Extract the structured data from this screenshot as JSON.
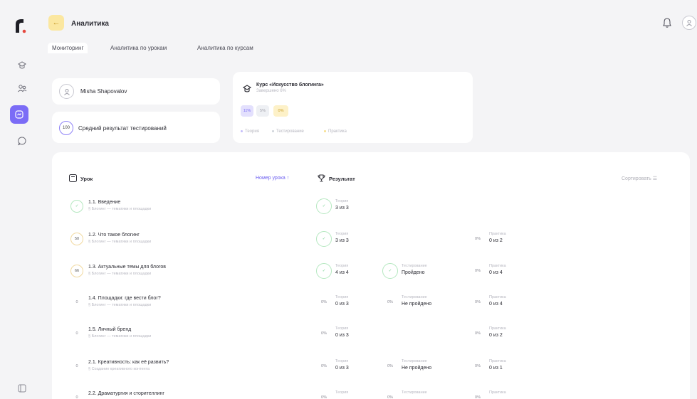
{
  "header": {
    "title": "Аналитика"
  },
  "tabs": [
    {
      "label": "Мониторинг",
      "active": true
    },
    {
      "label": "Аналитика по урокам",
      "active": false
    },
    {
      "label": "Аналитика по курсам",
      "active": false
    }
  ],
  "user": {
    "name": "Misha Shapovalov"
  },
  "score": {
    "badge": "100",
    "label": "Средний результат тестирований"
  },
  "course": {
    "title": "Курс «Искусство блогинга»",
    "subtitle": "Завершено 6%",
    "pills": [
      {
        "label": "11%",
        "color": "#e3e0fd",
        "text": "#7b6cf6"
      },
      {
        "label": "5%",
        "color": "#eef0f4",
        "text": "#a0a0aa"
      },
      {
        "label": "0%",
        "color": "#fdf1c8",
        "text": "#c9a02c"
      }
    ],
    "legend": [
      {
        "label": "Теория",
        "color": "#c4bdfb"
      },
      {
        "label": "Тестирование",
        "color": "#cfd3da"
      },
      {
        "label": "Практика",
        "color": "#f7df8d"
      }
    ]
  },
  "table": {
    "lesson_header": "Урок",
    "sort_lesson": "Номер урока",
    "result_header": "Результат",
    "sort_result": "Сортировать"
  },
  "lessons": [
    {
      "progress": "✓",
      "title": "1.1. Введение",
      "section": "§ Блогинг — тематики и площадки",
      "theory": {
        "cap": "Теория",
        "val": "3 из 3",
        "done": true
      }
    },
    {
      "progress": "50",
      "title": "1.2. Что такое блогинг",
      "section": "§ Блогинг — тематики и площадки",
      "theory": {
        "cap": "Теория",
        "val": "3 из 3",
        "done": true
      },
      "practice": {
        "cap": "Практика",
        "val": "0 из 2"
      }
    },
    {
      "progress": "66",
      "title": "1.3. Актуальные темы для блогов",
      "section": "§ Блогинг — тематики и площадки",
      "theory": {
        "cap": "Теория",
        "val": "4 из 4",
        "done": true
      },
      "test": {
        "cap": "Тестирование",
        "val": "Пройдено",
        "done": true
      },
      "practice": {
        "cap": "Практика",
        "val": "0 из 4"
      }
    },
    {
      "progress": "0",
      "title": "1.4. Площадки: где вести блог?",
      "section": "§ Блогинг — тематики и площадки",
      "theory": {
        "cap": "Теория",
        "val": "0 из 3"
      },
      "test": {
        "cap": "Тестирование",
        "val": "Не пройдено"
      },
      "practice": {
        "cap": "Практика",
        "val": "0 из 4"
      }
    },
    {
      "progress": "0",
      "title": "1.5. Личный бренд",
      "section": "§ Блогинг — тематики и площадки",
      "theory": {
        "cap": "Теория",
        "val": "0 из 3"
      },
      "practice": {
        "cap": "Практика",
        "val": "0 из 2"
      }
    },
    {
      "progress": "0",
      "title": "2.1. Креативность: как её развить?",
      "section": "§ Создание креативного контента",
      "theory": {
        "cap": "Теория",
        "val": "0 из 3"
      },
      "test": {
        "cap": "Тестирование",
        "val": "Не пройдено"
      },
      "practice": {
        "cap": "Практика",
        "val": "0 из 1"
      }
    },
    {
      "progress": "0",
      "title": "2.2. Драматургия и сторителлинг",
      "section": "",
      "theory": {
        "cap": "Теория",
        "val": ""
      },
      "test": {
        "cap": "Тестирование",
        "val": ""
      },
      "practice": {
        "cap": "Практика",
        "val": ""
      }
    }
  ]
}
